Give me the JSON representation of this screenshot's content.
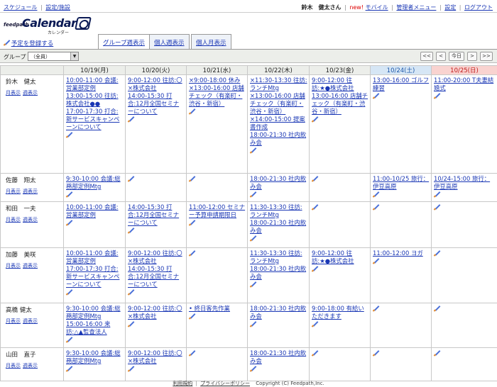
{
  "topbar": {
    "left_links": [
      "スケジュール",
      "設定/施設"
    ],
    "user_name": "鈴木　健太さん",
    "new_label": "new!",
    "right_links": [
      "モバイル",
      "管理者メニュー",
      "設定",
      "ログアウト"
    ]
  },
  "logo": {
    "brand": "feedpath",
    "product": "Calendar",
    "sub": "カレンダー"
  },
  "add_link": "予定を登録する",
  "tabs": [
    "グループ週表示",
    "個人週表示",
    "個人月表示"
  ],
  "group": {
    "label": "グループ",
    "selected": "（全員）"
  },
  "nav": {
    "prev_prev": "<<",
    "prev": "<",
    "today": "今日",
    "next": ">",
    "next_next": ">>"
  },
  "days": [
    "10/19(月)",
    "10/20(火)",
    "10/21(水)",
    "10/22(木)",
    "10/23(金)",
    "10/24(土)",
    "10/25(日)"
  ],
  "row_links": {
    "month": "月表示",
    "week": "週表示"
  },
  "users": [
    {
      "name": "鈴木　健太",
      "cells": [
        [
          "10:00-11:00 会議:営業部定例",
          "13:00-15:00 往訪:株式会社●●",
          "17:00-17:30 打合:新サービスキャンペーンについて"
        ],
        [
          "9:00-12:00 往訪:〇×株式会社",
          "14:00-15:30 打合:12月全国セミナーについて"
        ],
        [
          "×9:00-18:00 休み",
          "×13:00-16:00 店舗チェック（有楽町・渋谷・新宿）"
        ],
        [
          "×11:30-13:30 往訪:ランチMtg",
          "×13:00-16:00 店舗チェック（有楽町・渋谷・新宿）",
          "×14:00-15:00 提案書作成",
          "18:00-21:30 社内飲み会"
        ],
        [
          "9:00-12:00 往訪:★●株式会社",
          "13:00-16:00 店舗チェック（有楽町・渋谷・新宿）"
        ],
        [
          "13:00-16:00 ゴルフ練習"
        ],
        [
          "11:00-20:00 T夫妻結婚式"
        ]
      ]
    },
    {
      "name": "佐藤　翔太",
      "cells": [
        [
          "9:30-10:00 会議:総務部定例Mtg"
        ],
        [],
        [],
        [
          "18:00-21:30 社内飲み会"
        ],
        [],
        [
          "11:00-10/25 旅行：伊豆高原"
        ],
        [
          "10/24-15:00 旅行：伊豆高原"
        ]
      ]
    },
    {
      "name": "和田　一夫",
      "cells": [
        [
          "10:00-11:00 会議:営業部定例"
        ],
        [
          "14:00-15:30 打合:12月全国セミナーについて"
        ],
        [
          "11:00-12:00 セミナー予算申請期限日"
        ],
        [
          "11:30-13:30 往訪:ランチMtg",
          "18:00-21:30 社内飲み会"
        ],
        [],
        [],
        []
      ]
    },
    {
      "name": "加藤　美咲",
      "cells": [
        [
          "10:00-11:00 会議:営業部定例",
          "17:00-17:30 打合:新サービスキャンペーンについて"
        ],
        [
          "9:00-12:00 往訪:〇×株式会社",
          "14:00-15:30 打合:12月全国セミナーについて"
        ],
        [],
        [
          "11:30-13:30 往訪:ランチMtg",
          "18:00-21:30 社内飲み会"
        ],
        [
          "9:00-12:00 往訪:★●株式会社"
        ],
        [
          "11:00-12:00 ヨガ"
        ],
        []
      ]
    },
    {
      "name": "高橋 健太",
      "cells": [
        [
          "9:30-10:00 会議:総務部定例Mtg",
          "15:00-16:00 来訪:△▲監査法人"
        ],
        [
          "9:00-12:00 往訪:〇×株式会社"
        ],
        [
          "• 終日客先作業"
        ],
        [
          "18:00-21:30 社内飲み会"
        ],
        [
          "9:00-18:00 有給いただきます"
        ],
        [],
        []
      ]
    },
    {
      "name": "山田　直子",
      "cells": [
        [
          "9:30-10:00 会議:総務部定例Mtg"
        ],
        [
          "9:00-12:00 往訪:〇×株式会社"
        ],
        [],
        [
          "18:00-21:30 社内飲み会"
        ],
        [],
        [],
        []
      ]
    }
  ],
  "footer": {
    "links": [
      "利用規約",
      "プライバシーポリシー"
    ],
    "copyright": "Copyright (C) Feedpath,Inc."
  }
}
